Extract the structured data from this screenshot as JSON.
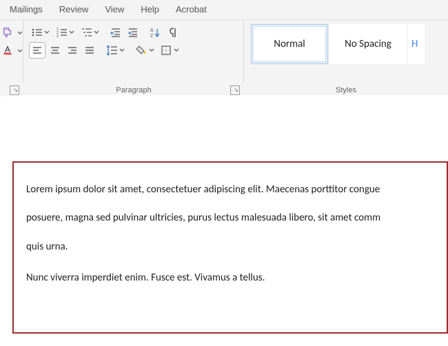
{
  "tabs": {
    "mailings": "Mailings",
    "review": "Review",
    "view": "View",
    "help": "Help",
    "acrobat": "Acrobat"
  },
  "groups": {
    "font": {
      "label": ""
    },
    "paragraph": {
      "label": "Paragraph"
    },
    "styles": {
      "label": "Styles"
    }
  },
  "styles": {
    "normal": "Normal",
    "nospacing": "No Spacing",
    "heading": "H"
  },
  "doc": {
    "p1_l1": "Lorem ipsum dolor sit amet, consectetuer adipiscing elit. Maecenas porttitor congue",
    "p1_l2": "posuere, magna sed pulvinar ultricies, purus lectus malesuada libero, sit amet comm",
    "p1_l3": "quis urna.",
    "p2": "Nunc viverra imperdiet enim. Fusce est. Vivamus a tellus."
  }
}
